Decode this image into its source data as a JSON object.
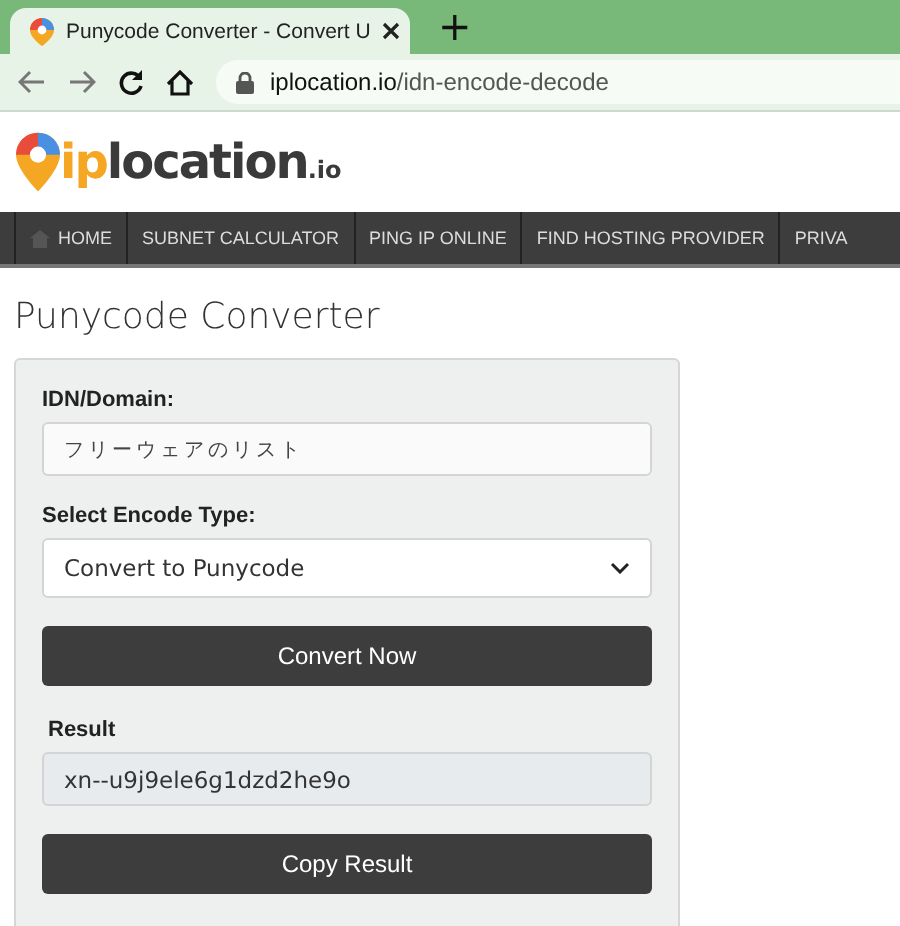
{
  "browser": {
    "tab_title": "Punycode Converter - Convert U",
    "new_tab": "+",
    "url_host": "iplocation.io",
    "url_path": "/idn-encode-decode"
  },
  "logo": {
    "accent": "ip",
    "main": "location",
    "suffix": ".io"
  },
  "nav": [
    {
      "label": "HOME",
      "kind": "home"
    },
    {
      "label": "SUBNET CALCULATOR",
      "kind": "plain"
    },
    {
      "label": "PING IP ONLINE",
      "kind": "plain"
    },
    {
      "label": "FIND HOSTING PROVIDER",
      "kind": "plain"
    },
    {
      "label": "PRIVA",
      "kind": "plain"
    }
  ],
  "page_title": "Punycode Converter",
  "form": {
    "domain_label": "IDN/Domain:",
    "domain_value": "フリーウェアのリスト",
    "encode_label": "Select Encode Type:",
    "encode_value": "Convert to Punycode",
    "convert_button": "Convert Now",
    "result_label": "Result",
    "result_value": "xn--u9j9ele6g1dzd2he9o",
    "copy_button": "Copy Result"
  }
}
